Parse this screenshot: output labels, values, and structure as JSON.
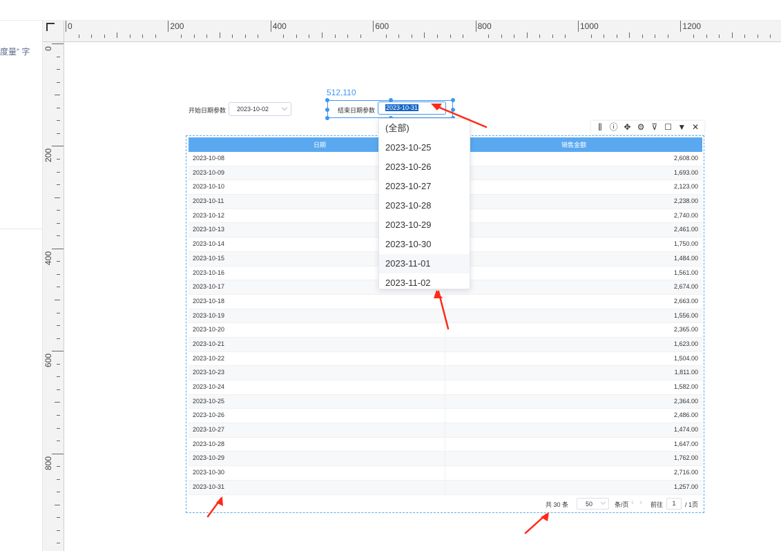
{
  "left_panel": {
    "clipped_text": "度量” 字"
  },
  "ruler": {
    "top_labels": [
      "0",
      "200",
      "400",
      "600",
      "800",
      "1000",
      "1200"
    ],
    "left_labels": [
      "0",
      "200",
      "400",
      "600",
      "800"
    ]
  },
  "start_param": {
    "label": "开始日期参数",
    "value": "2023-10-02"
  },
  "end_param": {
    "label": "结束日期参数",
    "value": "2023-10-31",
    "coord_readout": "512,110"
  },
  "toolbar": {
    "icons": [
      "chart-data-icon",
      "info-icon",
      "move-icon",
      "settings-icon",
      "filter-icon",
      "maximize-icon",
      "more-icon",
      "close-icon"
    ]
  },
  "dropdown": {
    "items": [
      "(全部)",
      "2023-10-25",
      "2023-10-26",
      "2023-10-27",
      "2023-10-28",
      "2023-10-29",
      "2023-10-30",
      "2023-11-01",
      "2023-11-02"
    ],
    "hovered_index": 7
  },
  "table": {
    "columns": [
      "日期",
      "销售金额"
    ],
    "rows": [
      [
        "2023-10-08",
        "2,608.00"
      ],
      [
        "2023-10-09",
        "1,693.00"
      ],
      [
        "2023-10-10",
        "2,123.00"
      ],
      [
        "2023-10-11",
        "2,238.00"
      ],
      [
        "2023-10-12",
        "2,740.00"
      ],
      [
        "2023-10-13",
        "2,461.00"
      ],
      [
        "2023-10-14",
        "1,750.00"
      ],
      [
        "2023-10-15",
        "1,484.00"
      ],
      [
        "2023-10-16",
        "1,561.00"
      ],
      [
        "2023-10-17",
        "2,674.00"
      ],
      [
        "2023-10-18",
        "2,663.00"
      ],
      [
        "2023-10-19",
        "1,556.00"
      ],
      [
        "2023-10-20",
        "2,365.00"
      ],
      [
        "2023-10-21",
        "1,623.00"
      ],
      [
        "2023-10-22",
        "1,504.00"
      ],
      [
        "2023-10-23",
        "1,811.00"
      ],
      [
        "2023-10-24",
        "1,582.00"
      ],
      [
        "2023-10-25",
        "2,364.00"
      ],
      [
        "2023-10-26",
        "2,486.00"
      ],
      [
        "2023-10-27",
        "1,474.00"
      ],
      [
        "2023-10-28",
        "1,647.00"
      ],
      [
        "2023-10-29",
        "1,762.00"
      ],
      [
        "2023-10-30",
        "2,716.00"
      ],
      [
        "2023-10-31",
        "1,257.00"
      ]
    ]
  },
  "pagination": {
    "total": "共 30 条",
    "page_size": "50",
    "per_page_label": "条/页",
    "goto_label": "前往",
    "current_page": "1",
    "total_pages": "/ 1页"
  },
  "colors": {
    "accent": "#3c96f0",
    "table_header": "#5aa9f0",
    "annotation_arrow": "#ff2a1a"
  }
}
